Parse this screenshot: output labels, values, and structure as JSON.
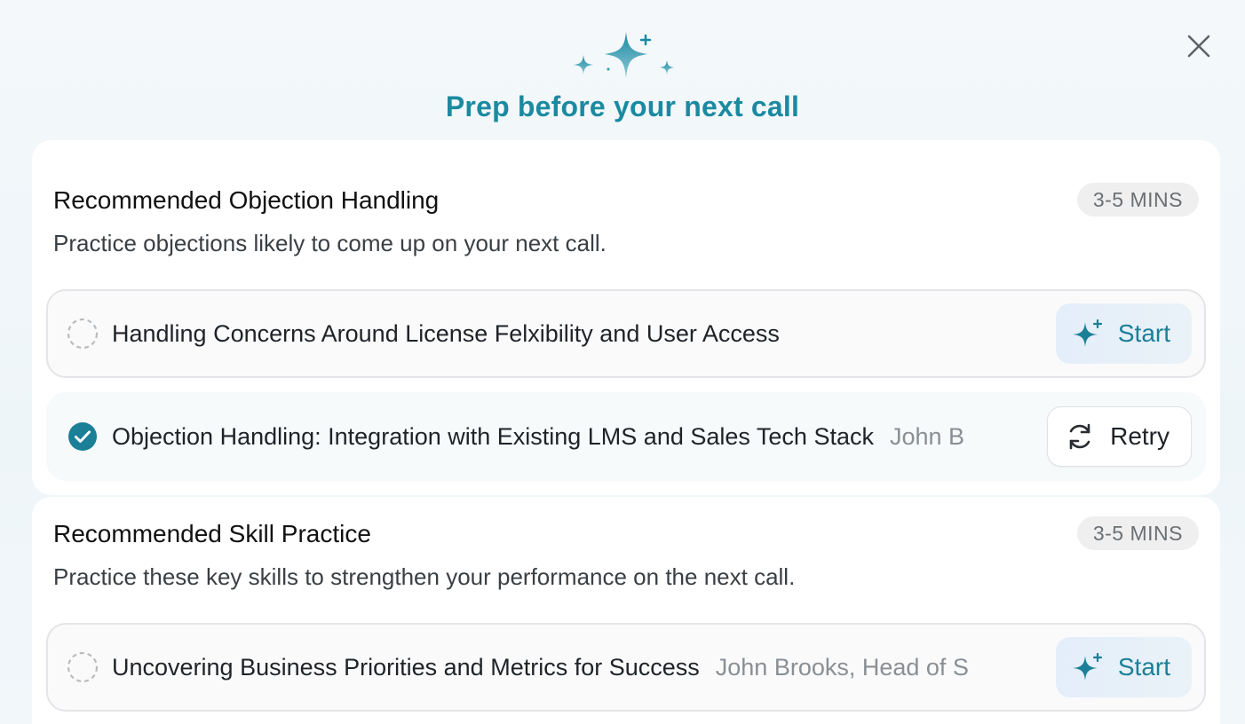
{
  "header": {
    "title": "Prep before your next call",
    "icon": "sparkles-icon",
    "accent_color": "#1b8aa0"
  },
  "close": {
    "icon": "close-icon"
  },
  "sections": [
    {
      "title": "Recommended Objection Handling",
      "badge": "3-5 MINS",
      "description": "Practice objections likely to come up on your next call.",
      "items": [
        {
          "label": "Handling Concerns Around License Felxibility and User Access",
          "subtext": "",
          "status": "not-started",
          "action": "Start",
          "action_icon": "sparkle-icon"
        },
        {
          "label": "Objection Handling: Integration with Existing LMS and Sales Tech Stack",
          "subtext": "John B",
          "status": "completed",
          "action": "Retry",
          "action_icon": "refresh-icon"
        }
      ]
    },
    {
      "title": "Recommended Skill Practice",
      "badge": "3-5 MINS",
      "description": "Practice these key skills to strengthen your performance on the next call.",
      "items": [
        {
          "label": "Uncovering Business Priorities and Metrics for Success",
          "subtext": "John Brooks, Head of S",
          "status": "not-started",
          "action": "Start",
          "action_icon": "sparkle-icon"
        }
      ]
    }
  ]
}
